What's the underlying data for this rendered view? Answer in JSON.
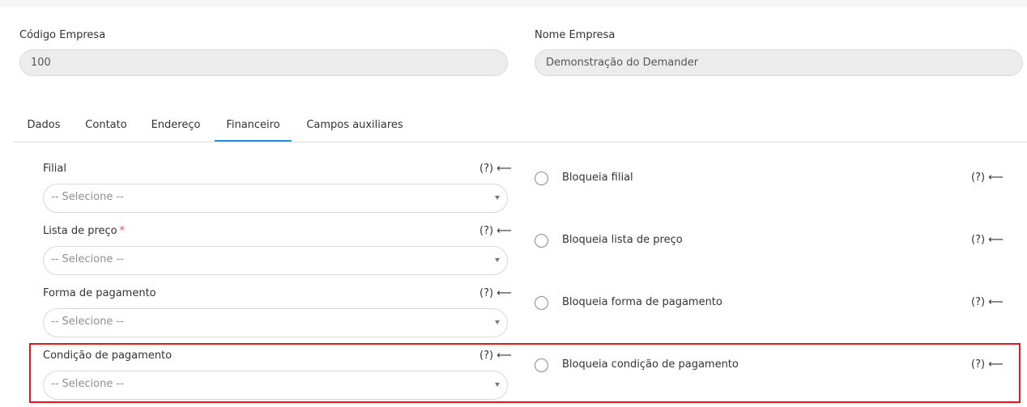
{
  "company": {
    "code_label": "Código Empresa",
    "code_value": "100",
    "name_label": "Nome Empresa",
    "name_value": "Demonstração do Demander"
  },
  "tabs": [
    {
      "label": "Dados",
      "active": false
    },
    {
      "label": "Contato",
      "active": false
    },
    {
      "label": "Endereço",
      "active": false
    },
    {
      "label": "Financeiro",
      "active": true
    },
    {
      "label": "Campos auxiliares",
      "active": false
    }
  ],
  "help_text": "(?) ⟵",
  "required_mark": "*",
  "select_placeholder": "-- Selecione --",
  "rows": [
    {
      "field_label": "Filial",
      "placeholder": "-- Selecione --",
      "lock_label": "Bloqueia filial"
    },
    {
      "field_label": "Lista de preço",
      "placeholder": "-- Selecione --",
      "lock_label": "Bloqueia lista de preço"
    },
    {
      "field_label": "Forma de pagamento",
      "placeholder": "-- Selecione --",
      "lock_label": "Bloqueia forma de pagamento"
    },
    {
      "field_label": "Condição de pagamento",
      "placeholder": "-- Selecione --",
      "lock_label": "Bloqueia condição de pagamento"
    }
  ],
  "colors": {
    "active_tab": "#2a8fd6",
    "highlight_border": "#e2141b",
    "required": "#d9534f"
  }
}
